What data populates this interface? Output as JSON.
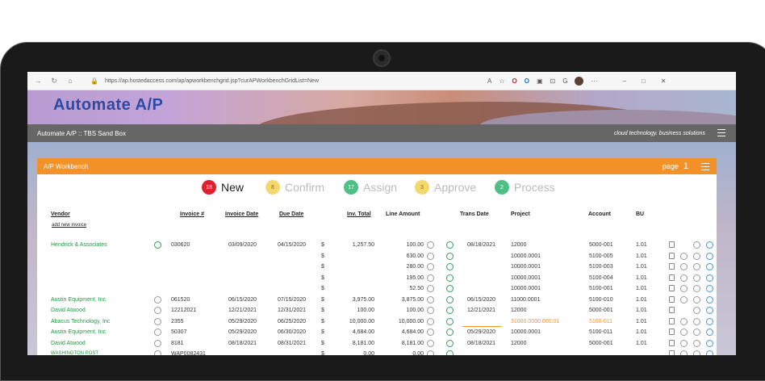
{
  "browser": {
    "url": "https://ap.hostedaccess.com/ap/apworkbenchgrid.jsp?curAPWorkbenchGridList=New",
    "tools": [
      "A",
      "☆",
      "O",
      "O",
      "▣",
      "⊡",
      "G",
      "···",
      "–",
      "□",
      "✕"
    ]
  },
  "app": {
    "logo": "Automate A/P",
    "breadcrumb": "Automate A/P :: TBS Sand Box",
    "tagline": "cloud technology. business solutions"
  },
  "panel": {
    "title": "A/P Workbench",
    "page_label": "page",
    "page_number": "1"
  },
  "steps": [
    {
      "count": "18",
      "label": "New",
      "color": "#e0202a",
      "active": true
    },
    {
      "count": "8",
      "label": "Confirm",
      "color": "#f3d870",
      "active": false
    },
    {
      "count": "17",
      "label": "Assign",
      "color": "#4fbf86",
      "active": false
    },
    {
      "count": "3",
      "label": "Approve",
      "color": "#f3d870",
      "active": false
    },
    {
      "count": "2",
      "label": "Process",
      "color": "#4fbf86",
      "active": false
    }
  ],
  "columns": {
    "vendor": "Vendor",
    "add_new_invoice": "add new invoice",
    "invoice": "Invoice #",
    "invoice_date": "Invoice Date",
    "due_date": "Due Date",
    "inv_total": "Inv. Total",
    "line_amount": "Line Amount",
    "trans_date": "Trans Date",
    "project": "Project",
    "account": "Account",
    "bu": "BU"
  },
  "rows": [
    {
      "vendor": "Hendrick & Associates",
      "invoice": "030620",
      "invoice_date": "03/09/2020",
      "due_date": "04/15/2020",
      "cur": "$",
      "total": "1,257.50",
      "line": "100.00",
      "trans": "08/18/2021",
      "project": "12000",
      "account": "5000-001",
      "bu": "1.01"
    },
    {
      "vendor": "",
      "invoice": "",
      "invoice_date": "",
      "due_date": "",
      "cur": "$",
      "total": "",
      "line": "630.00",
      "trans": "",
      "project": "10000.0001",
      "account": "5100-005",
      "bu": "1.01"
    },
    {
      "vendor": "",
      "invoice": "",
      "invoice_date": "",
      "due_date": "",
      "cur": "$",
      "total": "",
      "line": "280.00",
      "trans": "",
      "project": "10000.0001",
      "account": "5100-003",
      "bu": "1.01"
    },
    {
      "vendor": "",
      "invoice": "",
      "invoice_date": "",
      "due_date": "",
      "cur": "$",
      "total": "",
      "line": "195.00",
      "trans": "",
      "project": "10000.0001",
      "account": "5100-004",
      "bu": "1.01"
    },
    {
      "vendor": "",
      "invoice": "",
      "invoice_date": "",
      "due_date": "",
      "cur": "$",
      "total": "",
      "line": "52.50",
      "trans": "",
      "project": "10000.0001",
      "account": "5100-001",
      "bu": "1.01"
    },
    {
      "vendor": "Austin Equipment, Inc",
      "invoice": "061520",
      "invoice_date": "06/15/2020",
      "due_date": "07/15/2020",
      "cur": "$",
      "total": "3,975.00",
      "line": "3,875.00",
      "trans": "06/15/2020",
      "project": "11000.0001",
      "account": "5100-010",
      "bu": "1.01"
    },
    {
      "vendor": "David Atwood",
      "invoice": "12212021",
      "invoice_date": "12/21/2021",
      "due_date": "12/31/2021",
      "cur": "$",
      "total": "100.00",
      "line": "100.00",
      "trans": "12/21/2021",
      "project": "12000",
      "account": "5000-001",
      "bu": "1.01"
    },
    {
      "vendor": "Abacus Technology, Inc",
      "invoice": "2355",
      "invoice_date": "05/29/2020",
      "due_date": "06/25/2020",
      "cur": "$",
      "total": "10,000.00",
      "line": "10,000.00",
      "trans": "",
      "project": "31000.0000.000.01",
      "account": "5100-011",
      "bu": "1.01"
    },
    {
      "vendor": "Austin Equipment, Inc",
      "invoice": "50307",
      "invoice_date": "05/29/2020",
      "due_date": "06/30/2020",
      "cur": "$",
      "total": "4,684.00",
      "line": "4,684.00",
      "trans": "05/29/2020",
      "project": "10000.0001",
      "account": "5100-011",
      "bu": "1.01"
    },
    {
      "vendor": "David Atwood",
      "invoice": "8181",
      "invoice_date": "08/18/2021",
      "due_date": "08/31/2021",
      "cur": "$",
      "total": "8,181.00",
      "line": "8,181.00",
      "trans": "08/18/2021",
      "project": "12000",
      "account": "5000-001",
      "bu": "1.01"
    },
    {
      "vendor": "WASHINGTON POST",
      "invoice": "WAP0082431",
      "invoice_date": "",
      "due_date": "",
      "cur": "$",
      "total": "0.00",
      "line": "0.00",
      "trans": "",
      "project": "",
      "account": "",
      "bu": ""
    }
  ]
}
